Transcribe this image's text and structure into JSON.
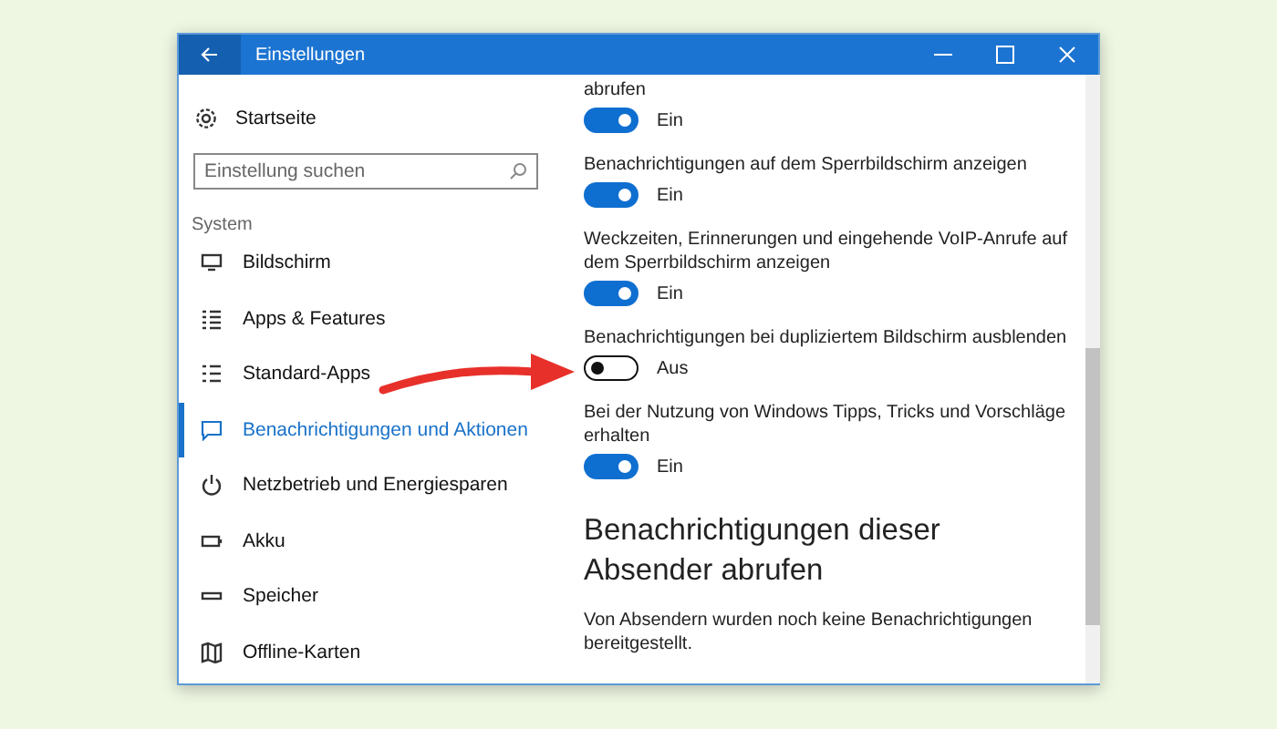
{
  "window": {
    "title": "Einstellungen"
  },
  "sidebar": {
    "home": "Startseite",
    "search": {
      "placeholder": "Einstellung suchen"
    },
    "section": "System",
    "items": [
      {
        "label": "Bildschirm",
        "kind": "display",
        "selected": false
      },
      {
        "label": "Apps & Features",
        "kind": "list",
        "selected": false
      },
      {
        "label": "Standard-Apps",
        "kind": "defaults",
        "selected": false
      },
      {
        "label": "Benachrichtigungen und Aktionen",
        "kind": "notify",
        "selected": true
      },
      {
        "label": "Netzbetrieb und Energiesparen",
        "kind": "power",
        "selected": false
      },
      {
        "label": "Akku",
        "kind": "battery",
        "selected": false
      },
      {
        "label": "Speicher",
        "kind": "storage",
        "selected": false
      },
      {
        "label": "Offline-Karten",
        "kind": "map",
        "selected": false
      }
    ]
  },
  "content": {
    "settings": [
      {
        "label": "abrufen",
        "on": true,
        "state": "Ein"
      },
      {
        "label": "Benachrichtigungen auf dem Sperrbildschirm anzeigen",
        "on": true,
        "state": "Ein"
      },
      {
        "label": "Weckzeiten, Erinnerungen und eingehende VoIP-Anrufe auf dem Sperrbildschirm anzeigen",
        "on": true,
        "state": "Ein"
      },
      {
        "label": "Benachrichtigungen bei dupliziertem Bildschirm ausblenden",
        "on": false,
        "state": "Aus"
      },
      {
        "label": "Bei der Nutzung von Windows Tipps, Tricks und Vorschläge erhalten",
        "on": true,
        "state": "Ein"
      }
    ],
    "section_title": "Benachrichtigungen dieser Absender abrufen",
    "note": "Von Absendern wurden noch keine Benachrichtigungen bereitgestellt."
  }
}
